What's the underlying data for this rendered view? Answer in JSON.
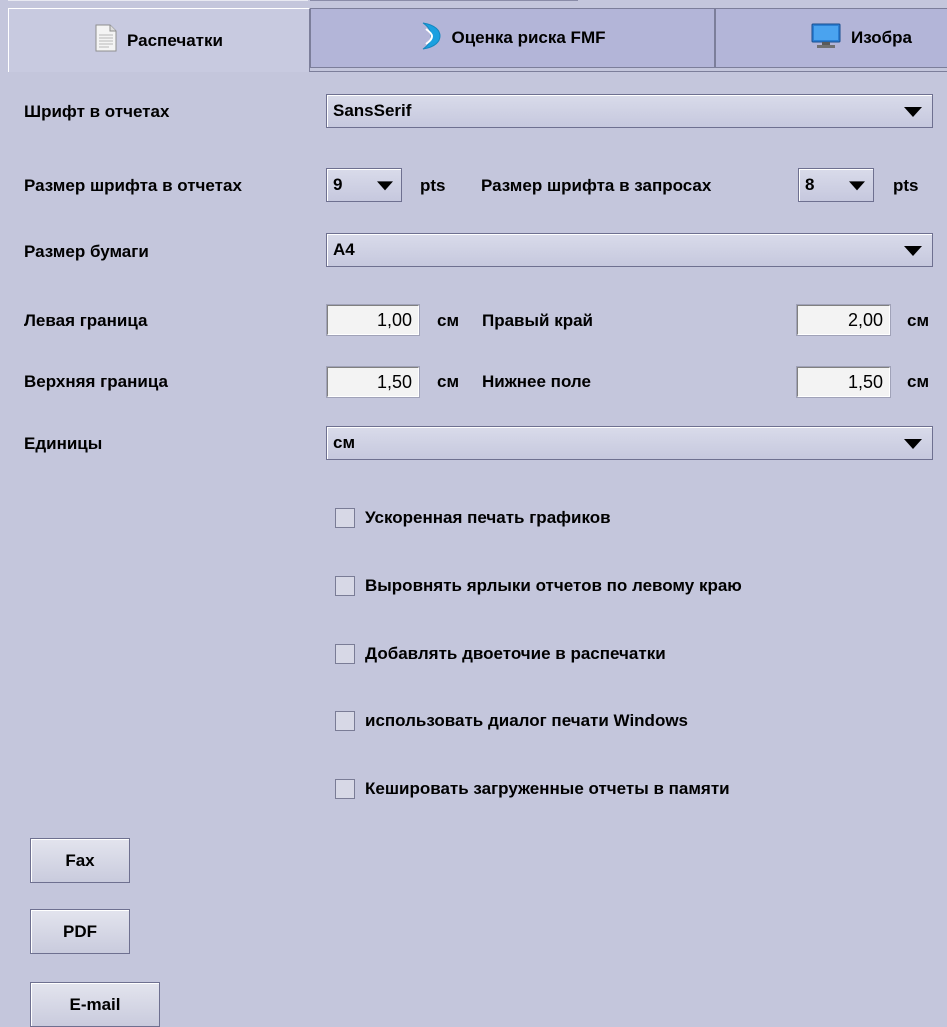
{
  "tabs": [
    {
      "label": "Распечатки",
      "icon": "document-icon",
      "active": true
    },
    {
      "label": "Оценка риска FMF",
      "icon": "risk-gauge-icon",
      "active": false
    },
    {
      "label": "Изобра",
      "icon": "monitor-icon",
      "active": false
    }
  ],
  "form": {
    "font_label": "Шрифт в отчетах",
    "font_value": "SansSerif",
    "report_font_size_label": "Размер шрифта в отчетах",
    "report_font_size_value": "9",
    "pts1": "pts",
    "query_font_size_label": "Размер шрифта в запросах",
    "query_font_size_value": "8",
    "pts2": "pts",
    "paper_label": "Размер бумаги",
    "paper_value": "A4",
    "left_margin_label": "Левая граница",
    "left_margin_value": "1,00",
    "left_margin_unit": "см",
    "right_margin_label": "Правый край",
    "right_margin_value": "2,00",
    "right_margin_unit": "см",
    "top_margin_label": "Верхняя граница",
    "top_margin_value": "1,50",
    "top_margin_unit": "см",
    "bottom_margin_label": "Нижнее поле",
    "bottom_margin_value": "1,50",
    "bottom_margin_unit": "см",
    "units_label": "Единицы",
    "units_value": "см"
  },
  "checkboxes": [
    {
      "label": "Ускоренная печать графиков",
      "checked": false
    },
    {
      "label": "Выровнять ярлыки отчетов по левому краю",
      "checked": false
    },
    {
      "label": "Добавлять двоеточие в распечатки",
      "checked": false
    },
    {
      "label": "использовать диалог печати Windows",
      "checked": false
    },
    {
      "label": "Кешировать загруженные отчеты в памяти",
      "checked": false
    }
  ],
  "buttons": {
    "fax": "Fax",
    "pdf": "PDF",
    "email": "E-mail"
  },
  "colors": {
    "background": "#c4c6dc",
    "risk_icon": "#1ba0e0",
    "monitor_icon": "#2a7fd4"
  }
}
